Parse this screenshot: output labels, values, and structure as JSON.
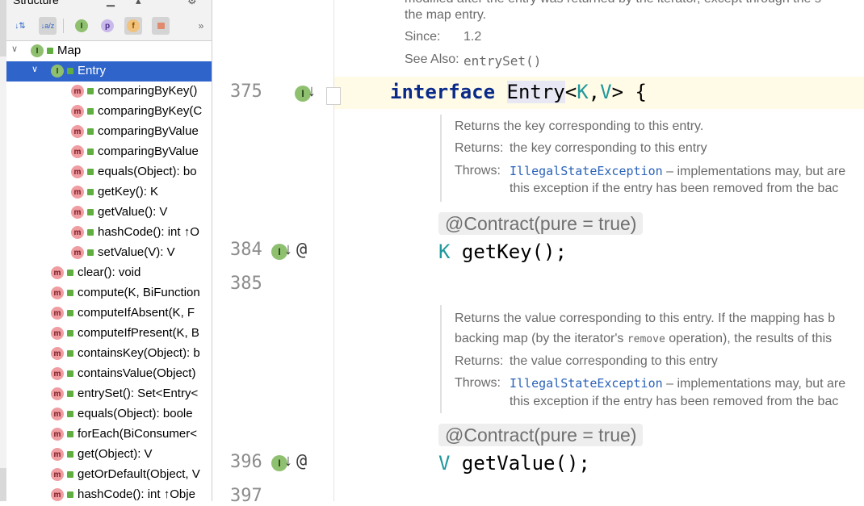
{
  "structure": {
    "title": "Structure",
    "toolbar": {
      "sort_visibility": "↓⇅",
      "sort_alpha": "↓a/z",
      "show_inherited": "I",
      "show_properties": "p",
      "show_fields": "f",
      "show_non_public": "🔒",
      "more": "»"
    },
    "tree": [
      {
        "label": "Map",
        "icon": "I",
        "indent": 0,
        "arrow": "∨"
      },
      {
        "label": "Entry",
        "icon": "I",
        "indent": 1,
        "arrow": "∨",
        "selected": true
      },
      {
        "label": "comparingByKey()",
        "icon": "m",
        "indent": 2
      },
      {
        "label": "comparingByKey(C",
        "icon": "m",
        "indent": 2
      },
      {
        "label": "comparingByValue",
        "icon": "m",
        "indent": 2
      },
      {
        "label": "comparingByValue",
        "icon": "m",
        "indent": 2
      },
      {
        "label": "equals(Object): bo",
        "icon": "m",
        "indent": 2
      },
      {
        "label": "getKey(): K",
        "icon": "m",
        "indent": 2
      },
      {
        "label": "getValue(): V",
        "icon": "m",
        "indent": 2
      },
      {
        "label": "hashCode(): int ↑O",
        "icon": "m",
        "indent": 2
      },
      {
        "label": "setValue(V): V",
        "icon": "m",
        "indent": 2
      },
      {
        "label": "clear(): void",
        "icon": "m",
        "indent": 1
      },
      {
        "label": "compute(K, BiFunction",
        "icon": "m",
        "indent": 1
      },
      {
        "label": "computeIfAbsent(K, F",
        "icon": "m",
        "indent": 1
      },
      {
        "label": "computeIfPresent(K, B",
        "icon": "m",
        "indent": 1
      },
      {
        "label": "containsKey(Object): b",
        "icon": "m",
        "indent": 1
      },
      {
        "label": "containsValue(Object)",
        "icon": "m",
        "indent": 1
      },
      {
        "label": "entrySet(): Set<Entry<",
        "icon": "m",
        "indent": 1
      },
      {
        "label": "equals(Object): boole",
        "icon": "m",
        "indent": 1
      },
      {
        "label": "forEach(BiConsumer<",
        "icon": "m",
        "indent": 1
      },
      {
        "label": "get(Object): V",
        "icon": "m",
        "indent": 1
      },
      {
        "label": "getOrDefault(Object, V",
        "icon": "m",
        "indent": 1
      },
      {
        "label": "hashCode(): int ↑Obje",
        "icon": "m",
        "indent": 1
      }
    ]
  },
  "editor": {
    "top_doc": {
      "line1": "modified after the entry was returned by the iterator, except through the s",
      "line2": "the map entry.",
      "since_label": "Since:",
      "since_value": "1.2",
      "see_also_label": "See Also:",
      "see_also_link": "entrySet()"
    },
    "lines": {
      "l375": "375",
      "l384": "384",
      "l385": "385",
      "l396": "396",
      "l397": "397"
    },
    "gutter_at": "@",
    "code375": {
      "kw": "interface",
      "name": "Entry",
      "open": "<",
      "k": "K",
      "comma": ",",
      "v": "V",
      "close": "> {"
    },
    "doc_key": {
      "desc": "Returns the key corresponding to this entry.",
      "returns_label": "Returns:",
      "returns_text": "the key corresponding to this entry",
      "throws_label": "Throws:",
      "throws_link": "IllegalStateException",
      "throws_text": " – implementations may, but are",
      "throws_text2": "this exception if the entry has been removed from the bac"
    },
    "anno1": "@Contract(pure = true)",
    "code384": {
      "type": "K",
      "rest": " getKey();"
    },
    "doc_value": {
      "desc1": "Returns the value corresponding to this entry. If the mapping has b",
      "desc2a": "backing map (by the iterator's ",
      "desc2_code": "remove",
      "desc2b": " operation), the results of this",
      "returns_label": "Returns:",
      "returns_text": "the value corresponding to this entry",
      "throws_label": "Throws:",
      "throws_link": "IllegalStateException",
      "throws_text": " – implementations may, but are",
      "throws_text2": "this exception if the entry has been removed from the bac"
    },
    "anno2": "@Contract(pure = true)",
    "code396": {
      "type": "V",
      "rest": " getValue();"
    }
  },
  "colors": {
    "selection": "#2f65ca",
    "keyword": "#0a2a8a",
    "type_param": "#20999d",
    "link": "#2a62b8",
    "interface_icon": "#8fc070",
    "method_icon": "#f09da2"
  }
}
